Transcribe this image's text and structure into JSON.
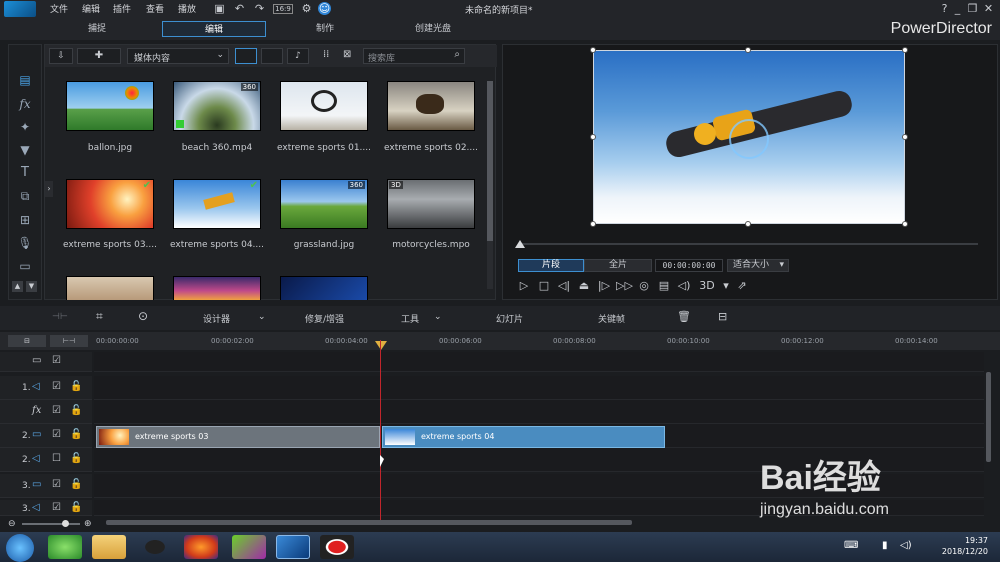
{
  "window": {
    "title": "未命名的新项目*",
    "brand": "PowerDirector"
  },
  "menu": [
    "文件",
    "编辑",
    "插件",
    "查看",
    "播放"
  ],
  "mode_tabs": [
    {
      "label": "捕捉"
    },
    {
      "label": "编辑"
    },
    {
      "label": "制作"
    },
    {
      "label": "创建光盘"
    }
  ],
  "library": {
    "dropdown": "媒体内容",
    "search_placeholder": "搜索库",
    "items": [
      {
        "name": "ballon.jpg",
        "badge": ""
      },
      {
        "name": "beach 360.mp4",
        "badge": "360"
      },
      {
        "name": "extreme sports 01....",
        "badge": ""
      },
      {
        "name": "extreme sports 02....",
        "badge": ""
      },
      {
        "name": "extreme sports 03....",
        "badge": ""
      },
      {
        "name": "extreme sports 04....",
        "badge": ""
      },
      {
        "name": "grassland.jpg",
        "badge": "360"
      },
      {
        "name": "motorcycles.mpo",
        "badge": "3D"
      }
    ]
  },
  "preview": {
    "tab_clip": "片段",
    "tab_full": "全片",
    "timecode": "00:00:00:00",
    "fit": "适合大小",
    "mode_3d": "3D"
  },
  "midbar": {
    "designer": "设计器",
    "fix": "修复/增强",
    "tools": "工具",
    "slideshow": "幻灯片",
    "keyframe": "关键帧"
  },
  "ruler": [
    "00:00:00:00",
    "00:00:02:00",
    "00:00:04:00",
    "00:00:06:00",
    "00:00:08:00",
    "00:00:10:00",
    "00:00:12:00",
    "00:00:14:00"
  ],
  "tracks": [
    {
      "label": "1."
    },
    {
      "label": "fx"
    },
    {
      "label": "2."
    },
    {
      "label": "2."
    },
    {
      "label": "3."
    },
    {
      "label": "3."
    }
  ],
  "clips": [
    {
      "label": "extreme sports 03"
    },
    {
      "label": "extreme sports 04"
    }
  ],
  "taskbar": {
    "time": "19:37",
    "date": "2018/12/20"
  },
  "watermark": {
    "text": "Bai经验",
    "url": "jingyan.baidu.com"
  }
}
